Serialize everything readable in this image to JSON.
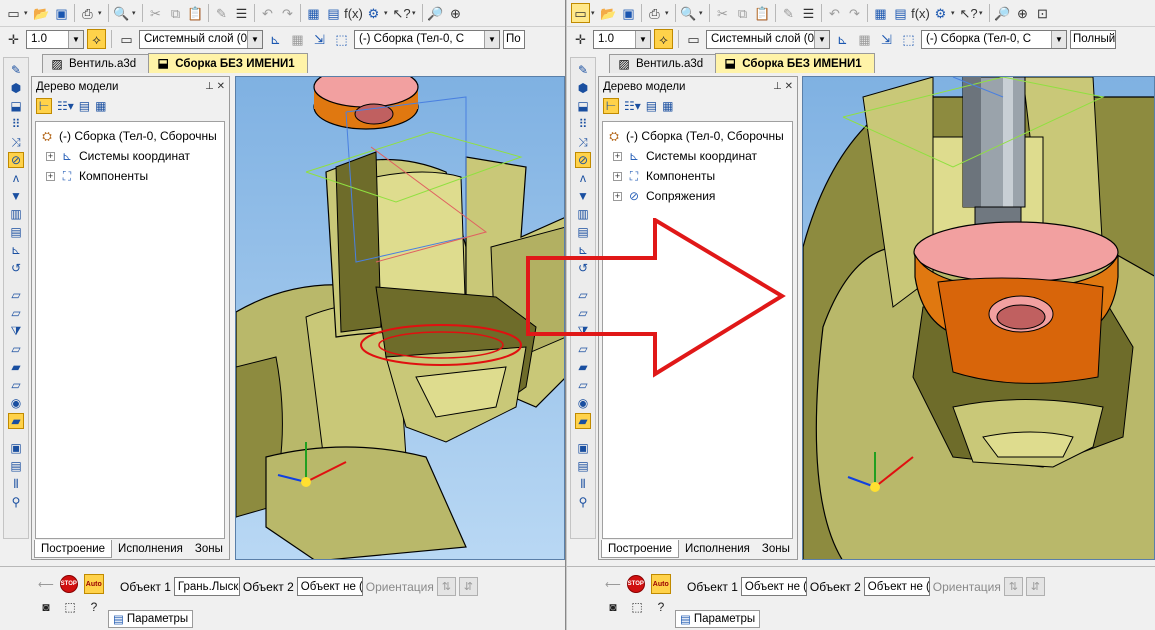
{
  "toolbar": {
    "scale_value": "1.0",
    "layer": "Системный слой (0)",
    "assembly_combo": "(-) Сборка (Тел-0, С",
    "view_mode_label": "По",
    "view_mode_label_right": "Полный"
  },
  "tabs": [
    {
      "label": "Вентиль.a3d",
      "active": false
    },
    {
      "label": "Сборка БЕЗ ИМЕНИ1",
      "active": true
    }
  ],
  "tree": {
    "title": "Дерево модели",
    "root": "(-) Сборка (Тел-0, Сборочны",
    "left_items": [
      "Системы координат",
      "Компоненты"
    ],
    "right_items": [
      "Системы координат",
      "Компоненты",
      "Сопряжения"
    ],
    "footer_tabs": [
      "Построение",
      "Исполнения",
      "Зоны"
    ]
  },
  "bottom": {
    "stop_label": "STOP",
    "auto_label": "Auto",
    "obj1_label": "Объект 1",
    "obj1_value_left": "Грань.Лыск",
    "obj1_value_right": "Объект не (",
    "obj2_label": "Объект 2",
    "obj2_value": "Объект не (",
    "orientation_label": "Ориентация",
    "params_tab": "Параметры"
  },
  "colors": {
    "model_body": "#c9c878",
    "model_shadow": "#6e6c2a",
    "washer": "#e07810",
    "washer_top": "#f2a0a0",
    "highlight": "#e01010",
    "arrow": "#e01818",
    "sky_top": "#7fb1e2",
    "sky_bottom": "#b9d8f4"
  }
}
